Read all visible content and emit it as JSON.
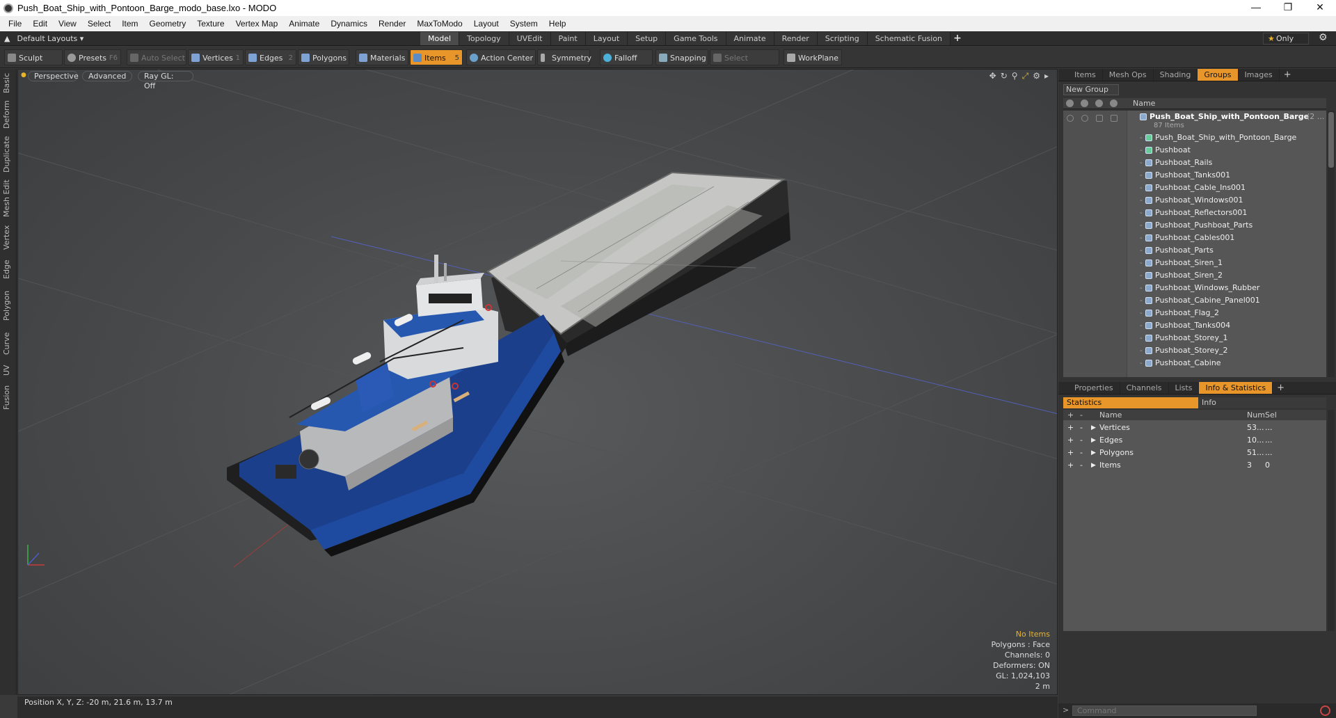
{
  "window": {
    "title": "Push_Boat_Ship_with_Pontoon_Barge_modo_base.lxo - MODO"
  },
  "menu": [
    "File",
    "Edit",
    "View",
    "Select",
    "Item",
    "Geometry",
    "Texture",
    "Vertex Map",
    "Animate",
    "Dynamics",
    "Render",
    "MaxToModo",
    "Layout",
    "System",
    "Help"
  ],
  "layout": {
    "name": "Default Layouts ▾",
    "tabs": [
      "Model",
      "Topology",
      "UVEdit",
      "Paint",
      "Layout",
      "Setup",
      "Game Tools",
      "Animate",
      "Render",
      "Scripting",
      "Schematic Fusion"
    ],
    "active_tab": "Model",
    "only_label": "Only"
  },
  "toolbar": {
    "sculpt": "Sculpt",
    "presets": "Presets",
    "presets_key": "F6",
    "auto_select": "Auto Select",
    "vertices": "Vertices",
    "vertices_count": "1",
    "edges": "Edges",
    "edges_count": "2",
    "polygons": "Polygons",
    "materials": "Materials",
    "items": "Items",
    "items_count": "5",
    "action_center": "Action Center",
    "symmetry": "Symmetry",
    "falloff": "Falloff",
    "snapping": "Snapping",
    "select_through": "Select Through",
    "workplane": "WorkPlane"
  },
  "left_tabs": [
    "Basic",
    "Deform",
    "Duplicate",
    "Mesh Edit",
    "Vertex",
    "Edge",
    "Polygon",
    "Curve",
    "UV",
    "Fusion"
  ],
  "viewport": {
    "perspective": "Perspective",
    "advanced": "Advanced",
    "raygl": "Ray GL: Off",
    "info": {
      "no_items": "No Items",
      "polygons": "Polygons : Face",
      "channels": "Channels: 0",
      "deformers": "Deformers: ON",
      "gl": "GL: 1,024,103",
      "scale": "2 m"
    }
  },
  "status": {
    "position": "Position X, Y, Z:  -20 m, 21.6 m, 13.7 m"
  },
  "items_panel": {
    "tabs": [
      "Items",
      "Mesh Ops",
      "Shading",
      "Groups",
      "Images"
    ],
    "active_tab": "Groups",
    "new_group": "New Group",
    "name_header": "Name",
    "root_name": "Push_Boat_Ship_with_Pontoon_Barge",
    "root_count": "(2 ...",
    "root_sub": "87 Items",
    "items": [
      "Push_Boat_Ship_with_Pontoon_Barge",
      "Pushboat",
      "Pushboat_Rails",
      "Pushboat_Tanks001",
      "Pushboat_Cable_Ins001",
      "Pushboat_Windows001",
      "Pushboat_Reflectors001",
      "Pushboat_Pushboat_Parts",
      "Pushboat_Cables001",
      "Pushboat_Parts",
      "Pushboat_Siren_1",
      "Pushboat_Siren_2",
      "Pushboat_Windows_Rubber",
      "Pushboat_Cabine_Panel001",
      "Pushboat_Flag_2",
      "Pushboat_Tanks004",
      "Pushboat_Storey_1",
      "Pushboat_Storey_2",
      "Pushboat_Cabine"
    ]
  },
  "props_panel": {
    "tabs": [
      "Properties",
      "Channels",
      "Lists",
      "Info & Statistics"
    ],
    "active_tab": "Info & Statistics",
    "statistics": "Statistics",
    "info": "Info",
    "headers": {
      "name": "Name",
      "num": "Num",
      "sel": "Sel"
    },
    "rows": [
      {
        "name": "Vertices",
        "num": "53...",
        "sel": "..."
      },
      {
        "name": "Edges",
        "num": "10...",
        "sel": "..."
      },
      {
        "name": "Polygons",
        "num": "51...",
        "sel": "..."
      },
      {
        "name": "Items",
        "num": "3",
        "sel": "0"
      }
    ]
  },
  "command": {
    "placeholder": "Command"
  }
}
